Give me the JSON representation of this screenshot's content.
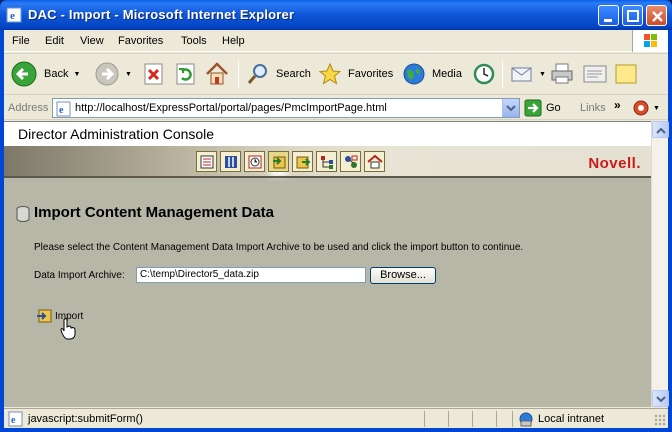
{
  "window": {
    "title": "DAC - Import - Microsoft Internet Explorer"
  },
  "menu": {
    "items": [
      "File",
      "Edit",
      "View",
      "Favorites",
      "Tools",
      "Help"
    ]
  },
  "toolbar": {
    "back_label": "Back",
    "search_label": "Search",
    "favorites_label": "Favorites",
    "media_label": "Media"
  },
  "address": {
    "label": "Address",
    "url": "http://localhost/ExpressPortal/portal/pages/PmcImportPage.html",
    "go_label": "Go",
    "links_label": "Links"
  },
  "page": {
    "console_title": "Director Administration Console",
    "brand": "Novell.",
    "section_title": "Import Content Management Data",
    "instructions": "Please select the Content Management Data Import Archive to be used and click the import button to continue.",
    "field_label": "Data Import Archive:",
    "field_value": "C:\\temp\\Director5_data.zip",
    "browse_label": "Browse...",
    "import_label": "Import",
    "nav_icons": [
      "list-icon",
      "columns-icon",
      "clock-icon",
      "import-icon",
      "export-icon",
      "tree-icon",
      "workflow-icon",
      "home-icon"
    ],
    "active_nav_index": 3
  },
  "status": {
    "text": "javascript:submitForm()",
    "zone": "Local intranet"
  },
  "colors": {
    "titlebar": "#0a5de8",
    "content_bg": "#b7b7a8",
    "brand_red": "#cc1a1a"
  }
}
